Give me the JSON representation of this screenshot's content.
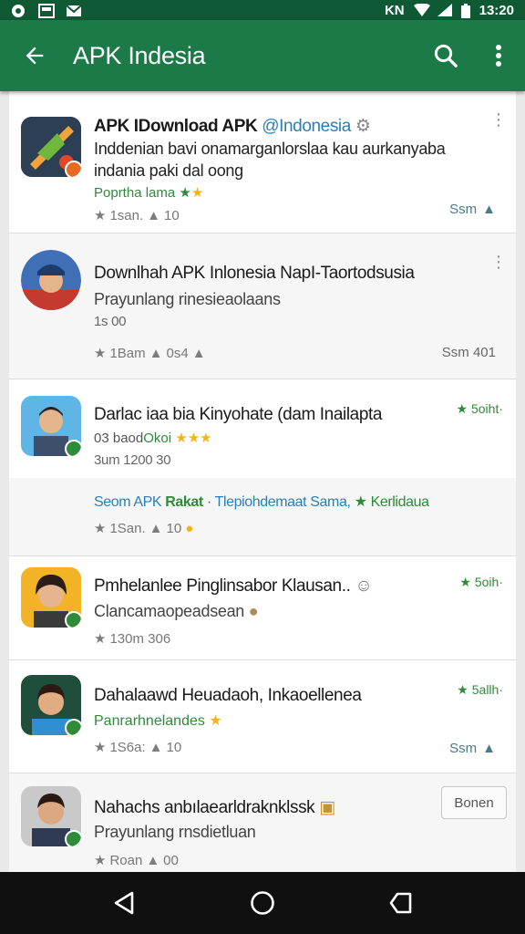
{
  "status_bar": {
    "network_label": "KN",
    "time": "13:20"
  },
  "app_bar": {
    "title": "APK Indesia"
  },
  "items": [
    {
      "title": "APK IDownload APK",
      "title_link": "@Indonesia",
      "desc_line1": "Inddenian bavi onamarganlorslaa kau aurkanyaba",
      "desc_line2": "indania paki dal oong",
      "tag": "Poprtha lama",
      "meta": "1san.",
      "meta2": "10",
      "right_label": "Ssm"
    },
    {
      "title": "Downlhah APK Inlonesia NapI-Taortodsusia",
      "desc": "Prayunlang rinesieaolaans",
      "sub": "1s 00",
      "meta": "1Bam",
      "meta2": "0s4",
      "right_label": "Ssm 401"
    },
    {
      "title": "Darlac iaa bia Kinyohate (dam Inailapta",
      "sub_prefix": "03 baod",
      "sub_green": "Okoi",
      "sub2": "3um 1200 30",
      "rating_right": "5oiht·",
      "promo_blue": "Seom APK",
      "promo_green1": "Rakat",
      "promo_mid": "Tlepiohdemaat Sama,",
      "promo_green2": "Kerlidaua",
      "meta": "1San.",
      "meta2": "10"
    },
    {
      "title": "Pmhelanlee Pinglinsabor Klausan..",
      "desc": "Clancamaopeadsean",
      "meta": "130m 306",
      "rating_right": "5oih·"
    },
    {
      "title": "Dahalaawd Heuadaoh, Inkaoellenea",
      "desc": "Panrarhnelandes",
      "meta": "1S6a:",
      "meta2": "10",
      "rating_right": "5allh·",
      "right_label": "Ssm"
    },
    {
      "title": "Nahachs anbılaearldraknklssk",
      "desc": "Prayunlang rnsdietluan",
      "meta": "Roan",
      "meta2": "00",
      "button_label": "Bonen"
    }
  ],
  "icons": [
    "back-arrow-icon",
    "search-icon",
    "more-vert-icon",
    "star-icon",
    "thumb-icon",
    "back-nav-icon",
    "home-nav-icon",
    "recents-nav-icon"
  ],
  "colors": {
    "app_bar": "#1b7a47",
    "status_bar": "#0f5a34",
    "accent_green": "#2e8b3a",
    "link_blue": "#2a7fb8"
  }
}
